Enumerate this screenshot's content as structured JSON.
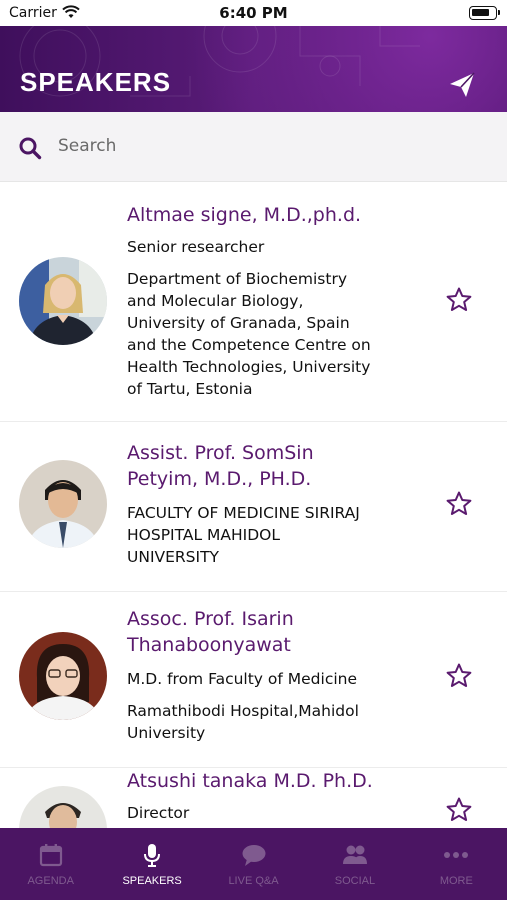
{
  "status_bar": {
    "carrier": "Carrier",
    "time": "6:40 PM"
  },
  "header": {
    "title": "SPEAKERS",
    "action_icon": "send-icon"
  },
  "search": {
    "placeholder": "Search"
  },
  "colors": {
    "brand_purple": "#4b1563",
    "name_purple": "#5a1a6e",
    "inactive_tab": "#7f5a8f"
  },
  "speakers": [
    {
      "name_lines": [
        "Altmae signe, M.D.,ph.d."
      ],
      "detail_lines": [
        "Senior researcher"
      ],
      "affiliation_lines": [
        "Department of Biochemistry",
        "and Molecular Biology,",
        "University of Granada, Spain",
        "and the Competence Centre on",
        "Health Technologies, University",
        "of Tartu, Estonia"
      ],
      "favorite": false
    },
    {
      "name_lines": [
        "Assist. Prof. SomSin",
        "Petyim, M.D., PH.D."
      ],
      "detail_lines": [
        "FACULTY OF MEDICINE SIRIRAJ",
        "HOSPITAL MAHIDOL",
        "UNIVERSITY"
      ],
      "affiliation_lines": [],
      "favorite": false
    },
    {
      "name_lines": [
        "Assoc. Prof. Isarin",
        "Thanaboonyawat"
      ],
      "detail_lines": [
        "M.D. from Faculty of Medicine"
      ],
      "affiliation_lines": [
        "Ramathibodi Hospital,Mahidol",
        "University"
      ],
      "favorite": false
    },
    {
      "name_lines": [
        "Atsushi tanaka M.D. Ph.D."
      ],
      "detail_lines": [
        "Director"
      ],
      "affiliation_lines": [],
      "favorite": false
    }
  ],
  "tabs": [
    {
      "label": "AGENDA",
      "icon": "calendar-icon",
      "active": false
    },
    {
      "label": "SPEAKERS",
      "icon": "microphone-icon",
      "active": true
    },
    {
      "label": "LIVE Q&A",
      "icon": "chat-bubble-icon",
      "active": false
    },
    {
      "label": "SOCIAL",
      "icon": "people-icon",
      "active": false
    },
    {
      "label": "MORE",
      "icon": "more-dots-icon",
      "active": false
    }
  ]
}
